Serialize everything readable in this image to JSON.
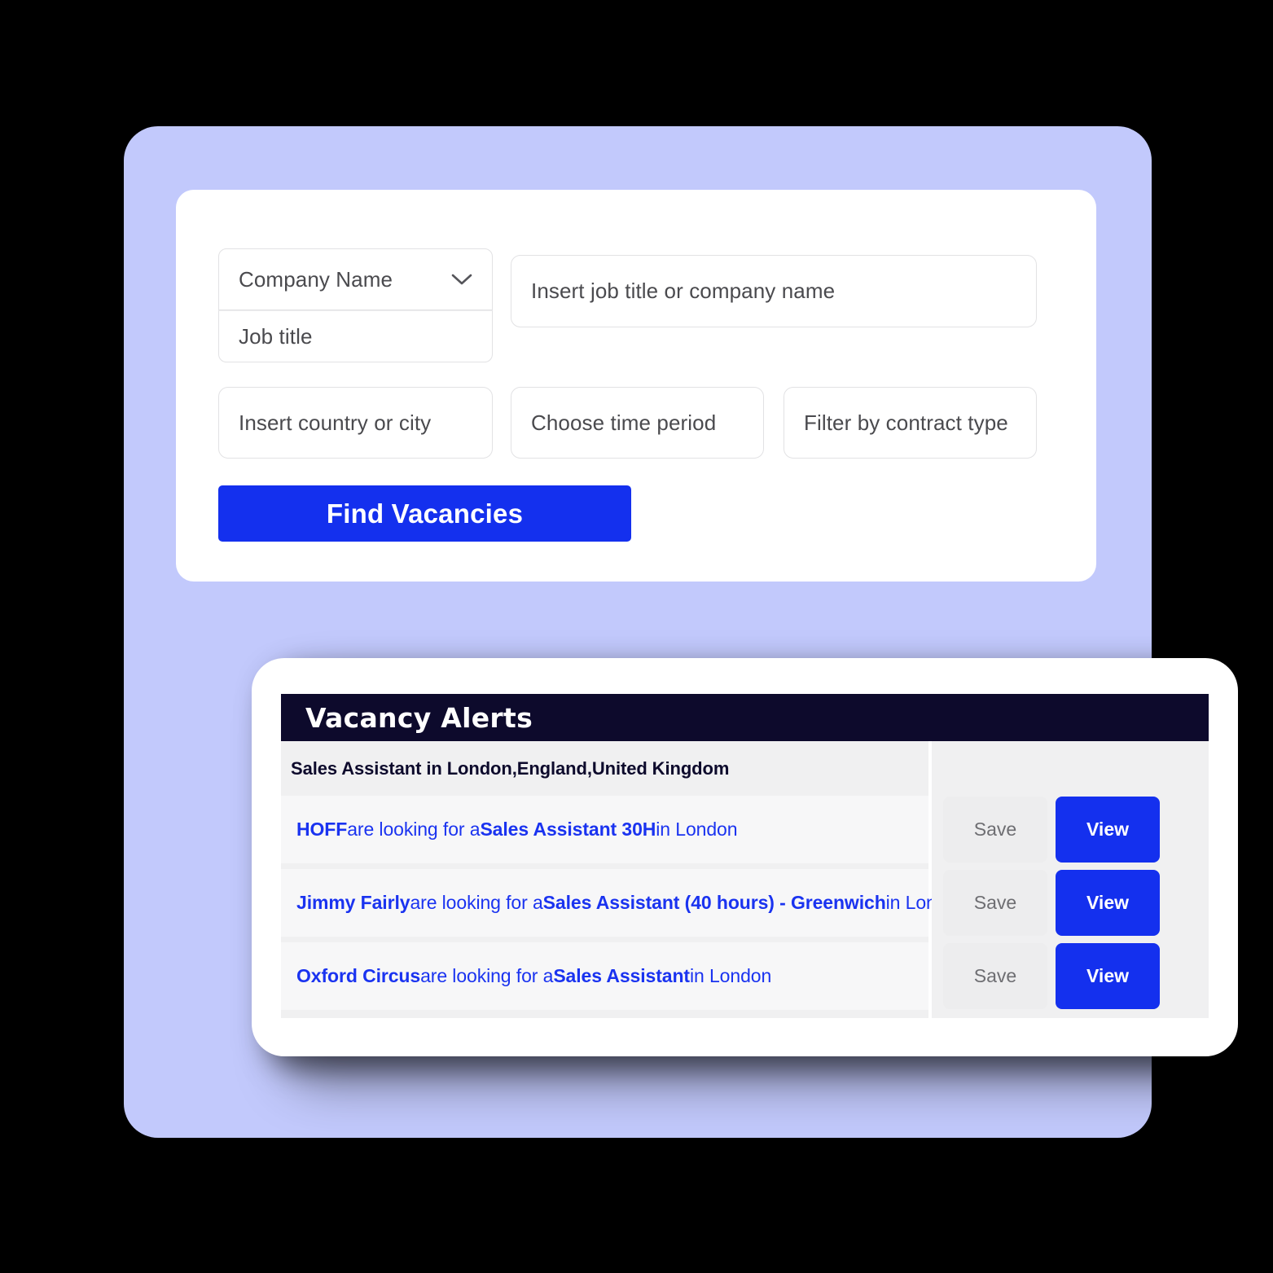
{
  "colors": {
    "background": "#000000",
    "panel_lavender": "#C2C9FC",
    "card_white": "#FFFFFF",
    "accent_blue": "#1430EE",
    "navy": "#0D0A2C",
    "link_blue": "#1A33F0",
    "field_border": "#E2E2E4",
    "row_bg": "#F7F7F8",
    "panel_grey": "#F0F0F1",
    "save_bg": "#EDEDEE",
    "save_text": "#6E6E72",
    "placeholder_text": "#4A4A4E"
  },
  "search_card": {
    "fields": [
      {
        "name": "company-name-select",
        "type": "select",
        "value": "Company Name",
        "icon": "chevron-down-icon"
      },
      {
        "name": "job-title-input",
        "type": "text",
        "value": "",
        "placeholder": "Job title"
      },
      {
        "name": "keyword-input",
        "type": "text",
        "value": "",
        "placeholder": "Insert job title or company name"
      },
      {
        "name": "location-input",
        "type": "text",
        "value": "",
        "placeholder": "Insert country or city"
      },
      {
        "name": "time-period-select",
        "type": "select",
        "value": "",
        "placeholder": "Choose time period"
      },
      {
        "name": "contract-type-select",
        "type": "select",
        "value": "",
        "placeholder": "Filter by contract type"
      }
    ],
    "submit_label": "Find Vacancies"
  },
  "alerts": {
    "header_title": "Vacancy Alerts",
    "subtitle": "Sales Assistant in London,England,United Kingdom",
    "save_label": "Save",
    "view_label": "View",
    "rows": [
      {
        "company": "HOFF",
        "connector": " are looking for a ",
        "job_title": "Sales Assistant 30H",
        "location_suffix": " in London"
      },
      {
        "company": "Jimmy Fairly",
        "connector": " are looking for a ",
        "job_title": "Sales Assistant (40 hours) - Greenwich",
        "location_suffix": " in London"
      },
      {
        "company": "Oxford Circus",
        "connector": " are looking for a ",
        "job_title": "Sales Assistant",
        "location_suffix": " in London"
      }
    ]
  }
}
